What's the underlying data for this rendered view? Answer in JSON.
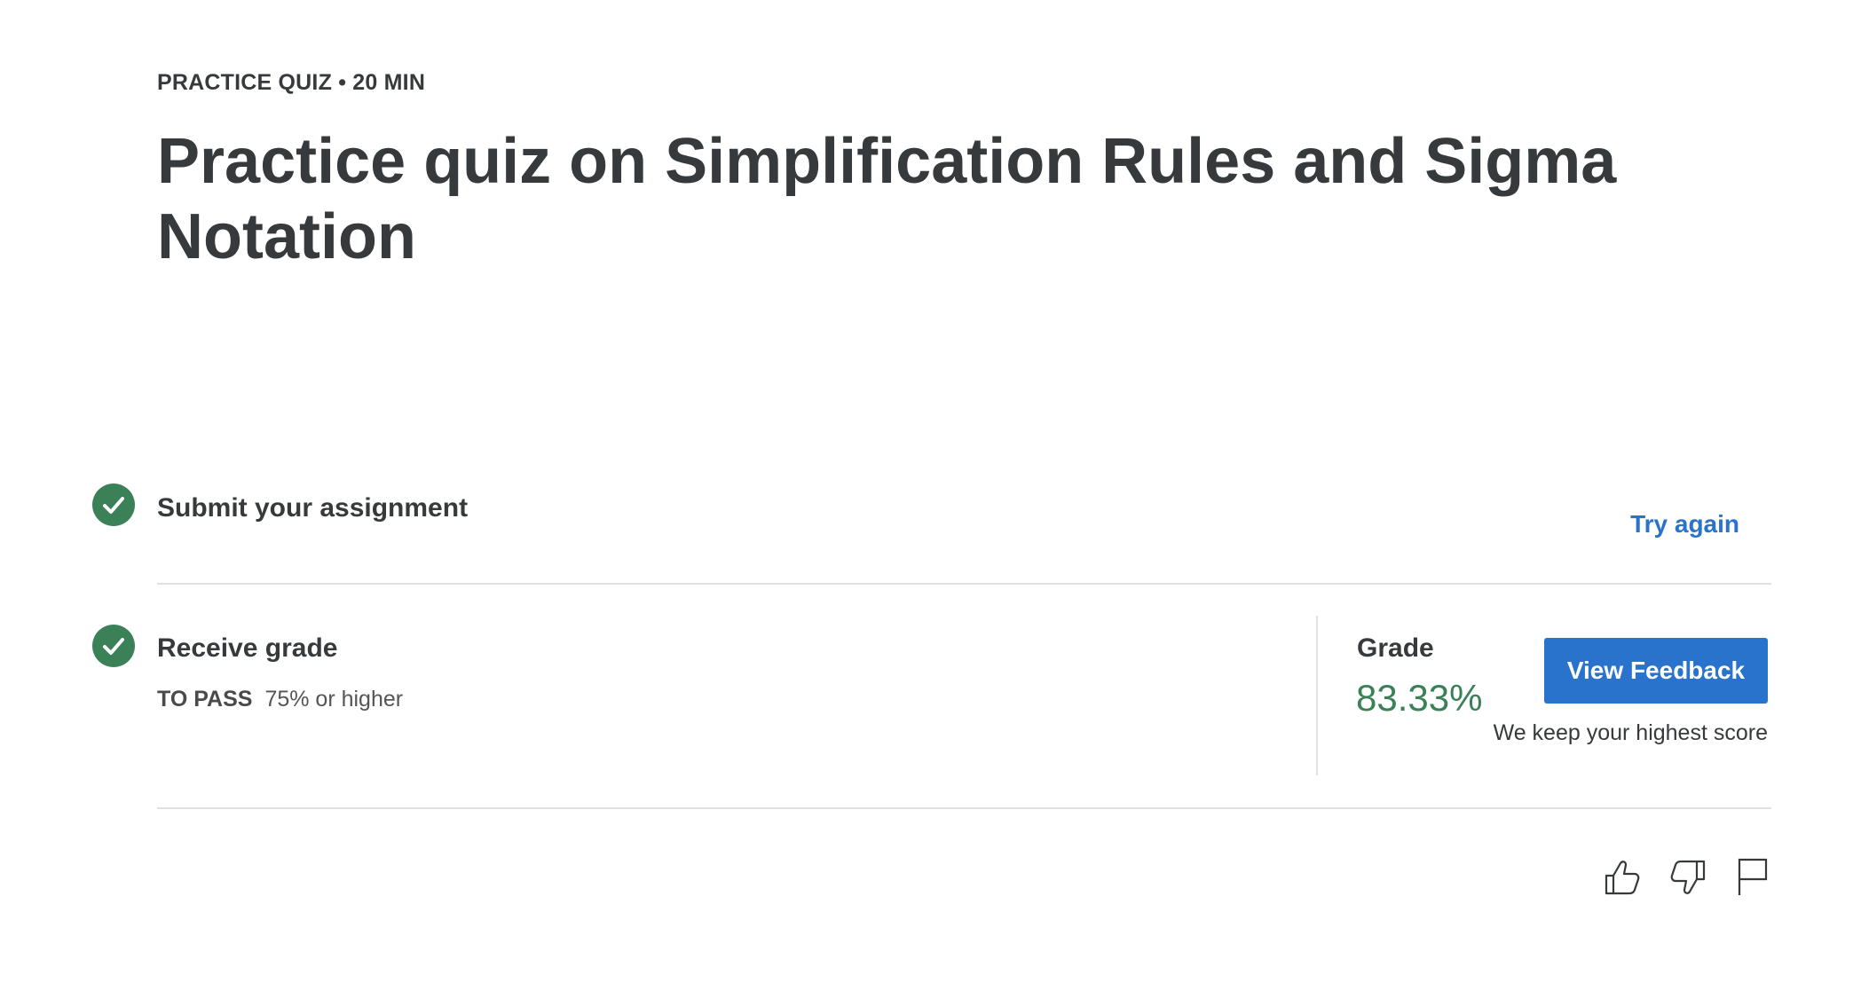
{
  "header": {
    "eyebrow": "PRACTICE QUIZ • 20 MIN",
    "title": "Practice quiz on Simplification Rules and Sigma Notation"
  },
  "steps": [
    {
      "title": "Submit your assignment",
      "status_icon": "check-circle-icon",
      "action_label": "Try again"
    },
    {
      "title": "Receive grade",
      "status_icon": "check-circle-icon",
      "to_pass_label": "TO PASS",
      "to_pass_value": "75% or higher"
    }
  ],
  "grade": {
    "label": "Grade",
    "value": "83.33%",
    "feedback_button": "View Feedback",
    "note": "We keep your highest score"
  },
  "footer_actions": [
    {
      "icon": "thumbs-up-icon"
    },
    {
      "icon": "thumbs-down-icon"
    },
    {
      "icon": "flag-icon"
    }
  ],
  "colors": {
    "success": "#3b8158",
    "link": "#2a73cc",
    "text": "#373a3c",
    "divider": "#e1e1e1"
  }
}
